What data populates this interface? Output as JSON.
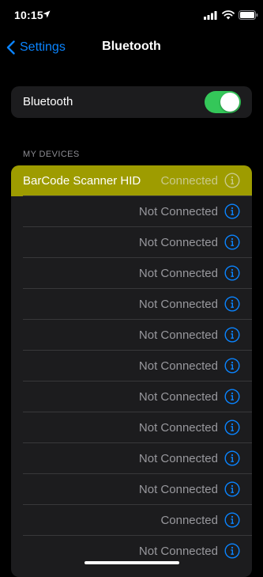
{
  "status_bar": {
    "time": "10:15"
  },
  "nav": {
    "back_label": "Settings",
    "title": "Bluetooth"
  },
  "bluetooth_toggle": {
    "label": "Bluetooth",
    "on": true
  },
  "section_header": "MY DEVICES",
  "colors": {
    "accent": "#0a84ff",
    "toggle_on": "#34c759",
    "highlight": "#9e9c00"
  },
  "devices": [
    {
      "name": "BarCode Scanner HID",
      "status": "Connected",
      "highlight": true
    },
    {
      "name": "",
      "status": "Not Connected"
    },
    {
      "name": "",
      "status": "Not Connected"
    },
    {
      "name": "",
      "status": "Not Connected"
    },
    {
      "name": "",
      "status": "Not Connected"
    },
    {
      "name": "",
      "status": "Not Connected"
    },
    {
      "name": "",
      "status": "Not Connected"
    },
    {
      "name": "",
      "status": "Not Connected"
    },
    {
      "name": "",
      "status": "Not Connected"
    },
    {
      "name": "",
      "status": "Not Connected"
    },
    {
      "name": "",
      "status": "Not Connected"
    },
    {
      "name": "",
      "status": "Connected"
    },
    {
      "name": "",
      "status": "Not Connected"
    }
  ]
}
